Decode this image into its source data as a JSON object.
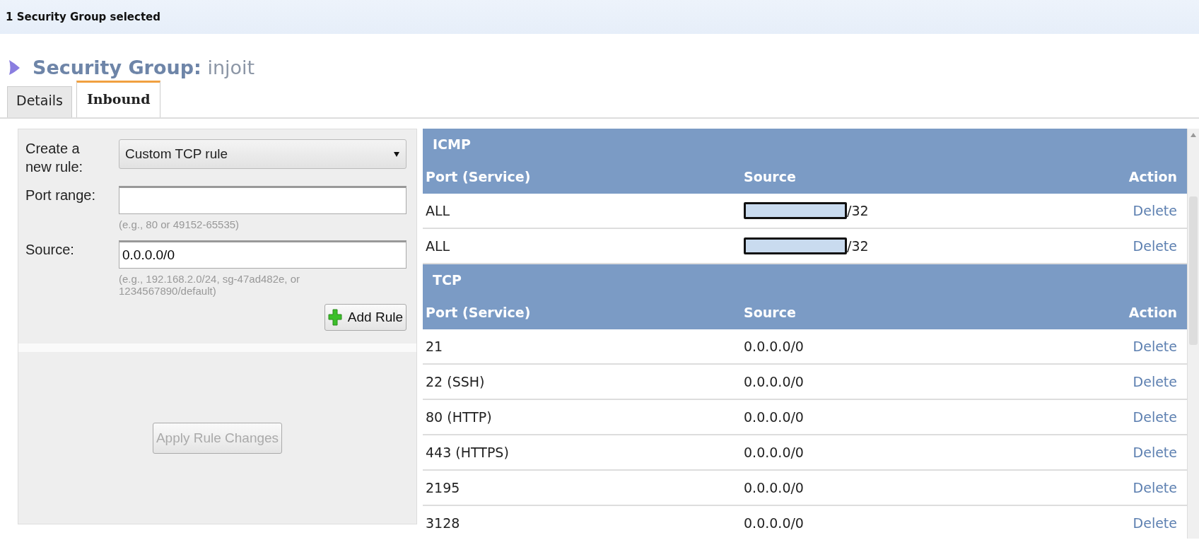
{
  "selection_bar": {
    "text": "1 Security Group selected"
  },
  "title": {
    "label": "Security Group:",
    "name": "injoit"
  },
  "tabs": [
    {
      "label": "Details",
      "selected": false
    },
    {
      "label": "Inbound",
      "selected": true
    }
  ],
  "form": {
    "rule_label": "Create a new rule:",
    "rule_value": "Custom TCP rule",
    "port_label": "Port range:",
    "port_hint": "(e.g., 80 or 49152-65535)",
    "source_label": "Source:",
    "source_value": "0.0.0.0/0",
    "source_hint": "(e.g., 192.168.2.0/24, sg-47ad482e, or 1234567890/default)",
    "add_button": "Add Rule",
    "apply_button": {
      "label": "Apply Rule Changes",
      "disabled": true
    }
  },
  "rule_groups": [
    {
      "protocol": "ICMP",
      "columns": [
        "Port (Service)",
        "Source",
        "Action"
      ],
      "rows": [
        {
          "port": "ALL",
          "source": "/32",
          "redacted": true,
          "action": "Delete"
        },
        {
          "port": "ALL",
          "source": "/32",
          "redacted": true,
          "action": "Delete"
        }
      ]
    },
    {
      "protocol": "TCP",
      "columns": [
        "Port (Service)",
        "Source",
        "Action"
      ],
      "rows": [
        {
          "port": "21",
          "source": "0.0.0.0/0",
          "redacted": false,
          "action": "Delete"
        },
        {
          "port": "22 (SSH)",
          "source": "0.0.0.0/0",
          "redacted": false,
          "action": "Delete"
        },
        {
          "port": "80 (HTTP)",
          "source": "0.0.0.0/0",
          "redacted": false,
          "action": "Delete"
        },
        {
          "port": "443 (HTTPS)",
          "source": "0.0.0.0/0",
          "redacted": false,
          "action": "Delete"
        },
        {
          "port": "2195",
          "source": "0.0.0.0/0",
          "redacted": false,
          "action": "Delete"
        },
        {
          "port": "3128",
          "source": "0.0.0.0/0",
          "redacted": false,
          "action": "Delete"
        }
      ]
    }
  ]
}
